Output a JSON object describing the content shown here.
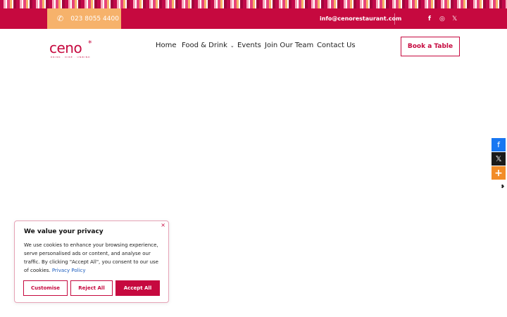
{
  "topbar": {
    "phone": "023 8055 4400",
    "phone_icon": "phone-icon",
    "email": "info@cenorestaurant.com",
    "social_icons": [
      "facebook-icon",
      "instagram-icon",
      "x-icon"
    ],
    "social_glyphs": {
      "facebook": "f",
      "instagram": "◎",
      "x": "𝕏"
    }
  },
  "logo": {
    "word": "ceno",
    "star": "*",
    "tagline": "DRINK · DINE · UNWIND"
  },
  "nav": {
    "items": [
      {
        "label": "Home"
      },
      {
        "label": "Food & Drink",
        "has_dropdown": true
      },
      {
        "label": "Events"
      },
      {
        "label": "Join Our Team"
      },
      {
        "label": "Contact Us"
      }
    ],
    "dropdown_glyph": "⌄"
  },
  "book_button": "Book a Table",
  "share_bar": {
    "facebook_glyph": "f",
    "x_glyph": "𝕏",
    "more_glyph": "+",
    "hide_glyph": "❥"
  },
  "cookie": {
    "close_glyph": "×",
    "title": "We value your privacy",
    "text": "We use cookies to enhance your browsing experience, serve personalised ads or content, and analyse our traffic. By clicking \"Accept All\", you consent to our use of cookies.",
    "link": "Privacy Policy",
    "customise": "Customise",
    "reject": "Reject All",
    "accept": "Accept All"
  },
  "colors": {
    "brand": "#c6093f",
    "phone_box": "#f6b26b",
    "facebook": "#1877f2",
    "more": "#f28c28"
  }
}
